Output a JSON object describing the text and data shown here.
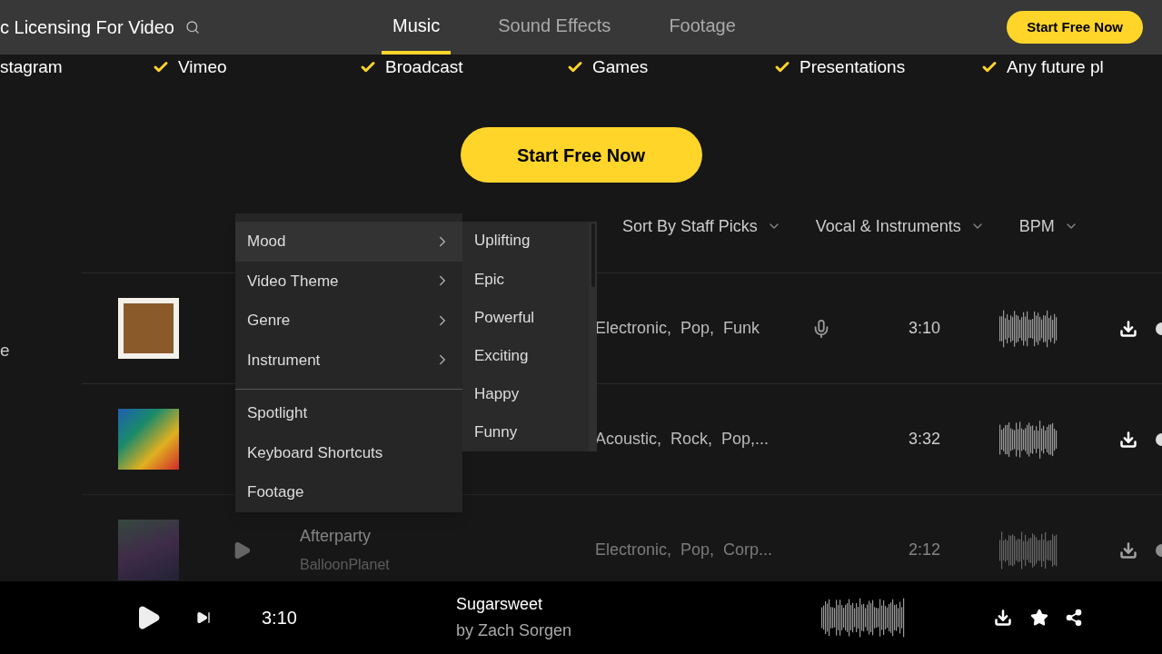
{
  "header": {
    "title": "c Licensing For Video",
    "nav": [
      {
        "label": "Music",
        "selected": true
      },
      {
        "label": "Sound Effects",
        "selected": false
      },
      {
        "label": "Footage",
        "selected": false
      }
    ],
    "cta": "Start Free Now"
  },
  "features": [
    "stagram",
    "Vimeo",
    "Broadcast",
    "Games",
    "Presentations",
    "Any future pl"
  ],
  "hero_cta": "Start Free Now",
  "filters": [
    "Sort By Staff Picks",
    "Vocal & Instruments",
    "BPM"
  ],
  "side_text": "e",
  "tracks": [
    {
      "genres": "Electronic,  Pop,  Funk",
      "vocals": true,
      "duration": "3:10",
      "dimmed": false
    },
    {
      "genres": "Acoustic,  Rock,  Pop,...",
      "vocals": false,
      "duration": "3:32",
      "dimmed": false
    },
    {
      "title": "Afterparty",
      "artist": "BalloonPlanet",
      "genres": "Electronic,  Pop,  Corp...",
      "vocals": false,
      "duration": "2:12",
      "dimmed": true
    }
  ],
  "menu": {
    "items": [
      {
        "label": "Mood",
        "submenu": true,
        "selected": true
      },
      {
        "label": "Video Theme",
        "submenu": true,
        "selected": false
      },
      {
        "label": "Genre",
        "submenu": true,
        "selected": false
      },
      {
        "label": "Instrument",
        "submenu": true,
        "selected": false
      }
    ],
    "extra_items": [
      "Spotlight",
      "Keyboard Shortcuts",
      "Footage"
    ],
    "submenu": [
      "Uplifting",
      "Epic",
      "Powerful",
      "Exciting",
      "Happy",
      "Funny"
    ]
  },
  "player": {
    "title": "Sugarsweet",
    "artist": "by Zach Sorgen",
    "time": "3:10"
  }
}
